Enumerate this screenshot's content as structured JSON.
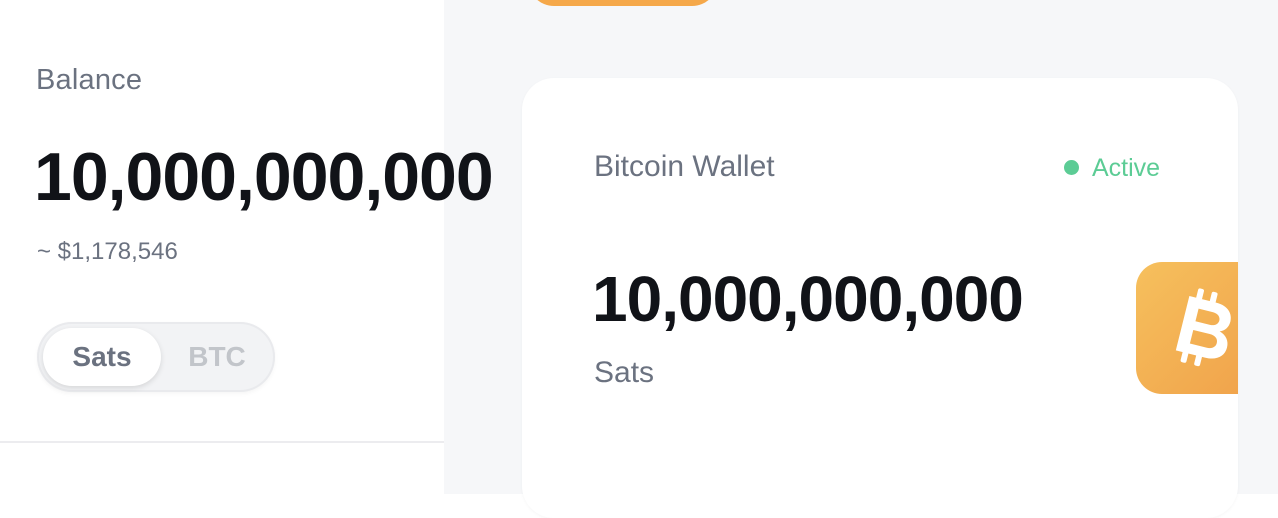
{
  "balance": {
    "label": "Balance",
    "amount": "10,000,000,000",
    "fiat": "~ $1,178,546"
  },
  "unit_toggle": {
    "options": [
      "Sats",
      "BTC"
    ],
    "selected": "Sats"
  },
  "wallet_card": {
    "name": "Bitcoin Wallet",
    "status": "Active",
    "amount": "10,000,000,000",
    "unit": "Sats",
    "icon": "bitcoin-icon"
  },
  "colors": {
    "accent_orange": "#f5a84a",
    "status_green": "#5ccc95",
    "text_dark": "#111318",
    "text_muted": "#6b7280"
  }
}
